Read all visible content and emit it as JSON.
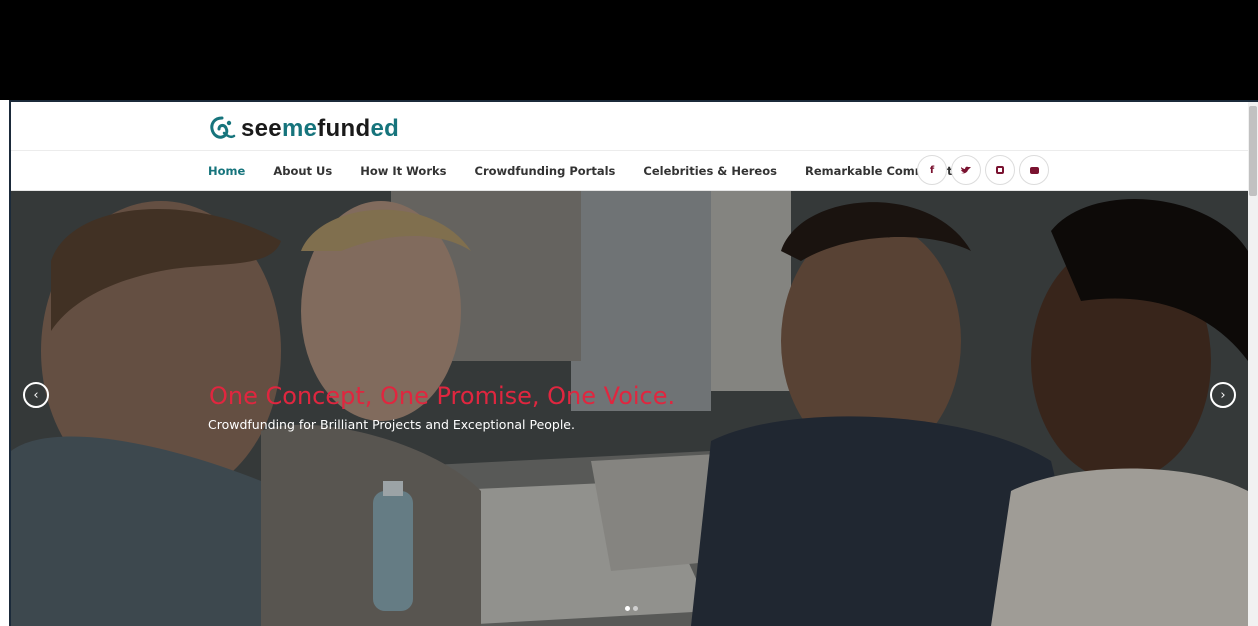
{
  "brand": {
    "logo_parts": [
      "see",
      "me",
      "fund",
      "ed"
    ],
    "accent_color": "#16747c",
    "secondary_color": "#7a1230"
  },
  "nav": {
    "items": [
      {
        "label": "Home",
        "active": true
      },
      {
        "label": "About Us",
        "active": false
      },
      {
        "label": "How It Works",
        "active": false
      },
      {
        "label": "Crowdfunding Portals",
        "active": false
      },
      {
        "label": "Celebrities & Hereos",
        "active": false
      },
      {
        "label": "Remarkable Communities",
        "active": false
      }
    ]
  },
  "social": {
    "facebook": {
      "icon": "facebook-icon",
      "glyph": "f"
    },
    "twitter": {
      "icon": "twitter-icon",
      "glyph": "🐦"
    },
    "instagram": {
      "icon": "instagram-icon"
    },
    "youtube": {
      "icon": "youtube-icon"
    }
  },
  "hero": {
    "title": "One Concept, One Promise, One Voice.",
    "subtitle": "Crowdfunding for Brilliant Projects and Exceptional People.",
    "title_color": "#e0263f",
    "prev_glyph": "‹",
    "next_glyph": "›",
    "slide_count": 2,
    "active_slide": 1
  }
}
